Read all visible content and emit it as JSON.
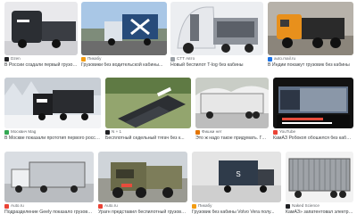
{
  "results": [
    {
      "source": "Dzen",
      "title": "В России создали первый грузовик...",
      "fav": "#202124"
    },
    {
      "source": "Пикабу",
      "title": "Грузовики без водительской кабины...",
      "fav": "#f39c12"
    },
    {
      "source": "CTT Авто",
      "title": "Новый беспилот T-log без кабины",
      "fav": "#9aa0a6"
    },
    {
      "source": "auto.mail.ru",
      "title": "В Индии покажут грузовик без кабины",
      "fav": "#1a73e8"
    },
    {
      "source": "Москвич Mag",
      "title": "В Москве показали прототип первого россий...",
      "fav": "#34a853"
    },
    {
      "source": "N + 1",
      "title": "Бесплотный седельный тягач без к...",
      "fav": "#202124"
    },
    {
      "source": "Фишки нет",
      "title": "Это ж надо такое придумать. Грузо...",
      "fav": "#e37400"
    },
    {
      "source": "YouTube",
      "title": "КамАЗ Робокоп обошелся без кабины",
      "fav": "#ea4335"
    },
    {
      "source": "Auto.ru",
      "title": "Подразделение Geely показало грузовик...",
      "fav": "#ea4335"
    },
    {
      "source": "Auto.ru",
      "title": "Урагн представил беспилотный грузовик...",
      "fav": "#ea4335"
    },
    {
      "source": "Пикабу",
      "title": "Грузовик без кабины Volvo Vera полу...",
      "fav": "#f39c12"
    },
    {
      "source": "Naked Science",
      "title": "КамАЗ» запатентовал электрич...",
      "fav": "#202124"
    }
  ],
  "thumb_labels": {
    "scania_logo": "S"
  }
}
